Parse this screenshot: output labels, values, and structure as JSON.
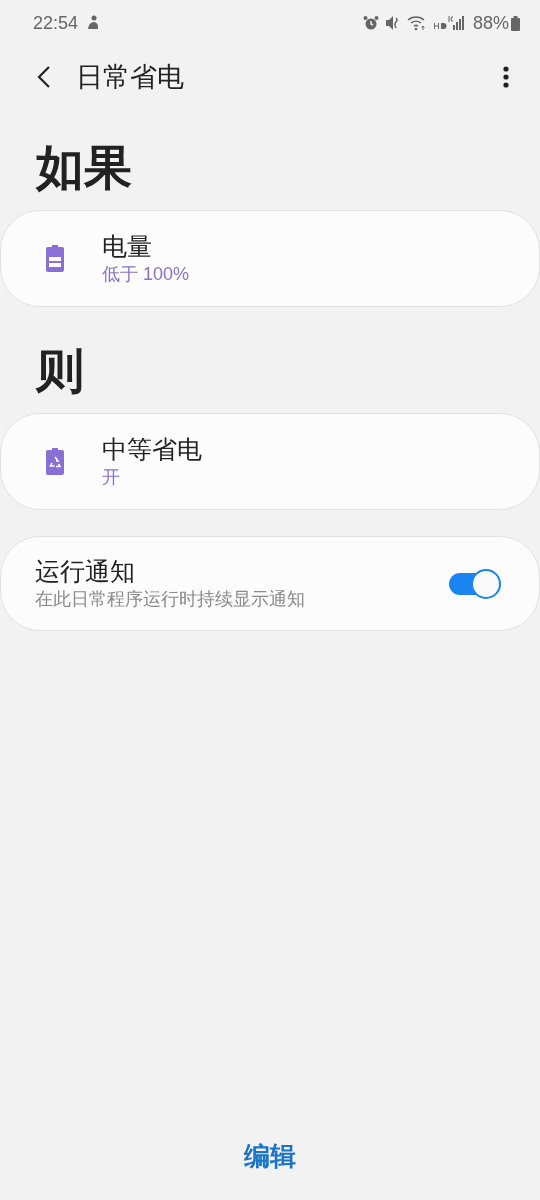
{
  "status_bar": {
    "time": "22:54",
    "battery": "88%"
  },
  "app_bar": {
    "title": "日常省电"
  },
  "sections": [
    {
      "heading": "如果",
      "card": {
        "kind": "battery",
        "title": "电量",
        "value": "低于 100%"
      }
    },
    {
      "heading": "则",
      "card": {
        "kind": "saver",
        "title": "中等省电",
        "value": "开"
      }
    }
  ],
  "notification": {
    "label": "运行通知",
    "description": "在此日常程序运行时持续显示通知",
    "on": true
  },
  "bottom_button": "编辑"
}
